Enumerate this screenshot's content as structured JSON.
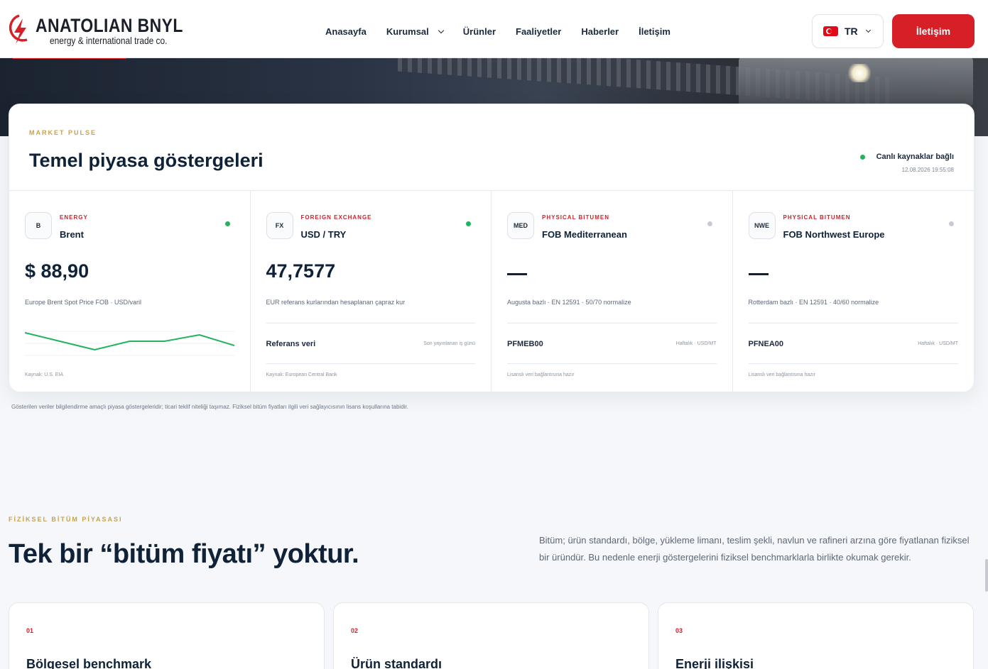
{
  "header": {
    "brand_name": "ANATOLIAN BNYL",
    "brand_sub": "energy & international trade co.",
    "nav": [
      "Anasayfa",
      "Kurumsal",
      "Ürünler",
      "Faaliyetler",
      "Haberler",
      "İletişim"
    ],
    "lang": "TR",
    "cta": "İletişim"
  },
  "market": {
    "eyebrow": "MARKET PULSE",
    "title": "Temel piyasa göstergeleri",
    "live_label": "Canlı kaynaklar bağlı",
    "live_time": "12.08.2026 19:55:08",
    "cards": [
      {
        "badge": "B",
        "category": "ENERGY",
        "name": "Brent",
        "value": "$ 88,90",
        "desc": "Europe Brent Spot Price FOB · USD/varil",
        "source": "Kaynak: U.S. EIA",
        "status_color": "#22b35e",
        "chart": [
          6,
          4,
          2,
          4,
          4,
          5.5,
          3
        ]
      },
      {
        "badge": "FX",
        "category": "FOREIGN EXCHANGE",
        "name": "USD / TRY",
        "value": "47,7577",
        "desc": "EUR referans kurlarından hesaplanan çapraz kur",
        "ref_label": "Referans veri",
        "ref_note": "Son yayınlanan iş günü",
        "source": "Kaynak: European Central Bank",
        "status_color": "#22b35e"
      },
      {
        "badge": "MED",
        "category": "PHYSICAL BITUMEN",
        "name": "FOB Mediterranean",
        "value": "—",
        "desc": "Augusta bazlı · EN 12591 · 50/70 normalize",
        "ref_label": "PFMEB00",
        "ref_note": "Haftalık · USD/MT",
        "source": "Lisanslı veri bağlantısına hazır",
        "status_color": "#c8ccd2"
      },
      {
        "badge": "NWE",
        "category": "PHYSICAL BITUMEN",
        "name": "FOB Northwest Europe",
        "value": "—",
        "desc": "Rotterdam bazlı · EN 12591 · 40/60 normalize",
        "ref_label": "PFNEA00",
        "ref_note": "Haftalık · USD/MT",
        "source": "Lisanslı veri bağlantısına hazır",
        "status_color": "#c8ccd2"
      }
    ],
    "disclaimer": "Gösterilen veriler bilgilendirme amaçlı piyasa göstergeleridir; ticari teklif niteliği taşımaz. Fiziksel bitüm fiyatları ilgili veri sağlayıcısının lisans koşullarına tabidir."
  },
  "section2": {
    "eyebrow": "FİZİKSEL BİTÜM PİYASASI",
    "headline": "Tek bir “bitüm fiyatı” yoktur.",
    "lede": "Bitüm; ürün standardı, bölge, yükleme limanı, teslim şekli, navlun ve rafineri arzına göre fiyatlanan fiziksel bir üründür. Bu nedenle enerji göstergelerini fiziksel benchmarklarla birlikte okumak gerekir.",
    "features": [
      {
        "num": "01",
        "title": "Bölgesel benchmark"
      },
      {
        "num": "02",
        "title": "Ürün standardı"
      },
      {
        "num": "03",
        "title": "Enerji ilişkisi"
      }
    ]
  },
  "colors": {
    "accent": "#d71f27",
    "gold": "#c9a24a",
    "navy": "#0f2238",
    "live": "#22b35e"
  }
}
